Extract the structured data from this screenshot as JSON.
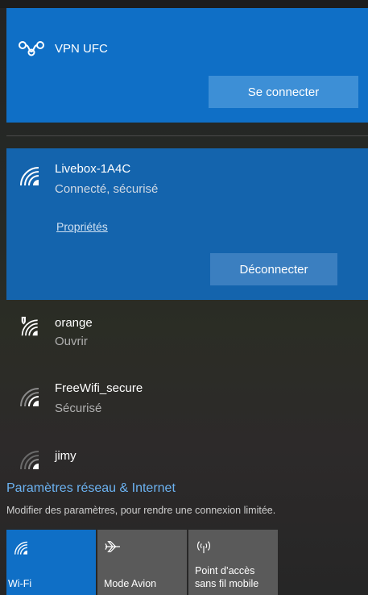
{
  "vpn": {
    "name": "VPN UFC",
    "connect_label": "Se connecter"
  },
  "connected_network": {
    "name": "Livebox-1A4C",
    "status": "Connecté, sécurisé",
    "properties_label": "Propriétés",
    "disconnect_label": "Déconnecter"
  },
  "networks": [
    {
      "name": "orange",
      "status": "Ouvrir",
      "secure": false
    },
    {
      "name": "FreeWifi_secure",
      "status": "Sécurisé",
      "secure": true
    },
    {
      "name": "jimy",
      "status": "",
      "secure": true
    }
  ],
  "settings": {
    "link_label": "Paramètres réseau & Internet",
    "description": "Modifier des paramètres, pour rendre une connexion limitée."
  },
  "quick_actions": [
    {
      "label": "Wi-Fi",
      "active": true,
      "icon": "wifi-icon"
    },
    {
      "label": "Mode Avion",
      "active": false,
      "icon": "airplane-icon"
    },
    {
      "label": "Point d’accès sans fil mobile",
      "label_line1": "Point d’accès",
      "label_line2": "sans fil mobile",
      "active": false,
      "icon": "hotspot-icon"
    }
  ],
  "colors": {
    "accent": "#0f6fc6",
    "connected_bg": "#1464ad",
    "link": "#6cb3f2"
  }
}
